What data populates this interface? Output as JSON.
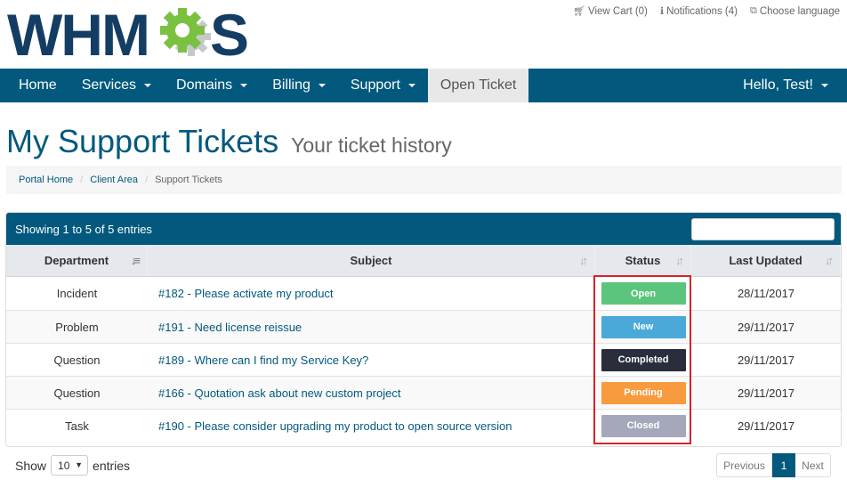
{
  "brand": {
    "logo_text": "WHMCS"
  },
  "top_links": [
    {
      "icon": "cart-icon",
      "label": "View Cart (0)"
    },
    {
      "icon": "info-icon",
      "label": "Notifications (4)"
    },
    {
      "icon": "language-icon",
      "label": "Choose language"
    }
  ],
  "nav": {
    "items": [
      {
        "label": "Home",
        "dropdown": false
      },
      {
        "label": "Services",
        "dropdown": true
      },
      {
        "label": "Domains",
        "dropdown": true
      },
      {
        "label": "Billing",
        "dropdown": true
      },
      {
        "label": "Support",
        "dropdown": true
      },
      {
        "label": "Open Ticket",
        "dropdown": false,
        "active": true
      }
    ],
    "user_menu": "Hello, Test!"
  },
  "page": {
    "title": "My Support Tickets",
    "subtitle": "Your ticket history"
  },
  "breadcrumb": [
    "Portal Home",
    "Client Area",
    "Support Tickets"
  ],
  "table": {
    "info": "Showing 1 to 5 of 5 entries",
    "search_value": "",
    "columns": [
      "Department",
      "Subject",
      "Status",
      "Last Updated"
    ],
    "rows": [
      {
        "department": "Incident",
        "subject": "#182 - Please activate my product",
        "status": "Open",
        "updated": "28/11/2017"
      },
      {
        "department": "Problem",
        "subject": "#191 - Need license reissue",
        "status": "New",
        "updated": "29/11/2017"
      },
      {
        "department": "Question",
        "subject": "#189 - Where can I find my Service Key?",
        "status": "Completed",
        "updated": "29/11/2017"
      },
      {
        "department": "Question",
        "subject": "#166 - Quotation ask about new custom project",
        "status": "Pending",
        "updated": "29/11/2017"
      },
      {
        "department": "Task",
        "subject": "#190 - Please consider upgrading my product to open source version",
        "status": "Closed",
        "updated": "29/11/2017"
      }
    ],
    "status_colors": {
      "Open": "#5bc57d",
      "New": "#4aa9d8",
      "Completed": "#2a2e3c",
      "Pending": "#f89a3e",
      "Closed": "#a5a8bb"
    }
  },
  "footer": {
    "show_label": "Show",
    "page_size": "10",
    "entries_label": "entries",
    "prev_label": "Previous",
    "current_page": "1",
    "next_label": "Next"
  },
  "colors": {
    "primary": "#02597d",
    "logo_green": "#7ac142",
    "logo_grey": "#c7c8ca"
  }
}
